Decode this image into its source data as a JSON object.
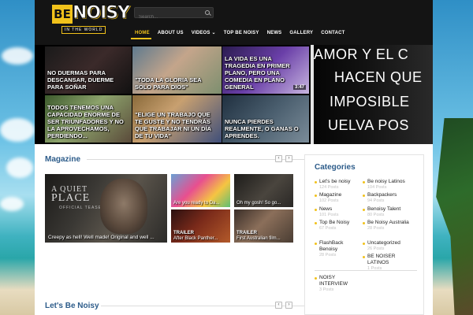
{
  "header": {
    "logo": {
      "primary": "BE",
      "secondary": "NOISY",
      "tagline": "IN THE WORLD"
    },
    "search_placeholder": "Search...",
    "nav": [
      {
        "label": "HOME",
        "active": true
      },
      {
        "label": "ABOUT US"
      },
      {
        "label": "VIDEOS ⌄"
      },
      {
        "label": "TOP BE NOISY"
      },
      {
        "label": "NEWS"
      },
      {
        "label": "GALLERY"
      },
      {
        "label": "CONTACT"
      }
    ]
  },
  "slider": {
    "tiles": [
      {
        "caption": "NO DUERMAS PARA DESCANSAR, DUERME PARA SOÑAR"
      },
      {
        "caption": "\"TODA LA GLORIA SEA SOLO PARA DIOS\""
      },
      {
        "caption": "LA VIDA ES UNA TRAGEDIA EN PRIMER PLANO, PERO UNA COMEDIA EN PLANO GENERAL",
        "duration": "3:47"
      },
      {
        "caption": "TODOS TENEMOS UNA CAPACIDAD ENORME DE SER TRIUNFADORES Y NO LA APROVECHAMOS, PERDIENDO..."
      },
      {
        "caption": "\"ELIGE UN TRABAJO QUE TE GUSTE Y NO TENDRÁS QUE TRABAJAR NI UN DÍA DE TU VIDA\""
      },
      {
        "caption": "NUNCA PIERDES REALMENTE, O GANAS O APRENDES."
      }
    ],
    "big_slide_lines": [
      "AMOR Y EL C",
      "HACEN QUE",
      "IMPOSIBLE",
      "UELVA POS"
    ]
  },
  "magazine": {
    "title": "Magazine",
    "main_caption": "Creepy as hell! Well made! Original and well ...",
    "main_poster": {
      "line1": "A QUIET",
      "line2": "PLACE",
      "sub": "OFFICIAL TEASER TRAILER"
    },
    "small": [
      {
        "caption": "Are you ready to Da..."
      },
      {
        "caption": "Oh my gosh! So go..."
      },
      {
        "tag": "TRAILER",
        "caption": "After Black Panther..."
      },
      {
        "tag": "TRAILER",
        "caption": "First Australian film..."
      }
    ]
  },
  "lets_be_noisy": {
    "title": "Let's Be Noisy"
  },
  "categories": {
    "title": "Categories",
    "left": [
      {
        "name": "Let's be noisy",
        "count": "124 Posts"
      },
      {
        "name": "Magazine",
        "count": "102 Posts"
      },
      {
        "name": "News",
        "count": "101 Posts"
      },
      {
        "name": "Top Be Noisy",
        "count": "67 Posts"
      },
      {
        "name": "FlashBack Benoisy",
        "count": "28 Posts"
      },
      {
        "name": "NOISY INTERVIEW",
        "count": "3 Posts"
      }
    ],
    "right": [
      {
        "name": "Be noisy Latinos",
        "count": "104 Posts"
      },
      {
        "name": "Backpackers",
        "count": "94 Posts"
      },
      {
        "name": "Benoisy Talent",
        "count": "80 Posts"
      },
      {
        "name": "Be Noisy Australia",
        "count": "28 Posts"
      },
      {
        "name": "Uncategorized",
        "count": "26 Posts"
      },
      {
        "name": "BE NOISER LATINOS",
        "count": "1 Posts"
      }
    ]
  },
  "colors": {
    "accent": "#f1c21b",
    "heading": "#2d5c8a",
    "header_bg": "#141414"
  }
}
